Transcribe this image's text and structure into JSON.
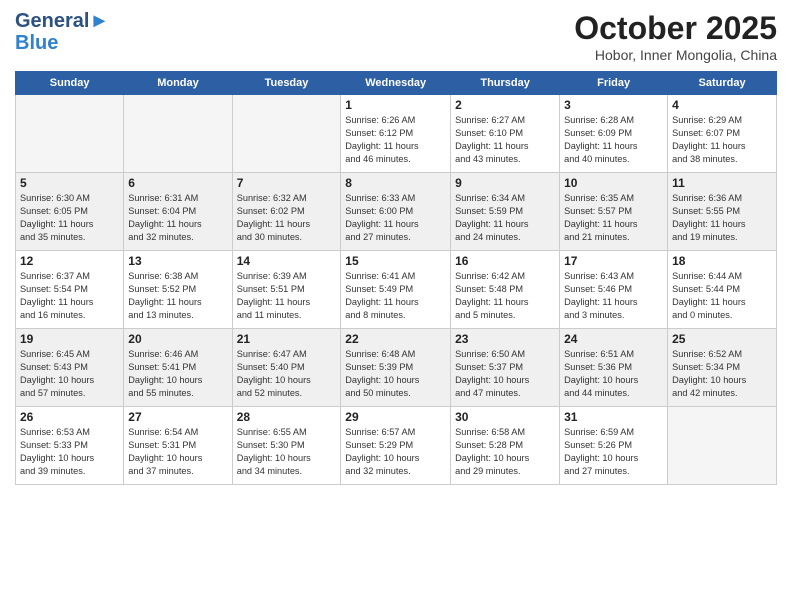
{
  "header": {
    "logo_line1": "General",
    "logo_line2": "Blue",
    "month": "October 2025",
    "location": "Hobor, Inner Mongolia, China"
  },
  "weekdays": [
    "Sunday",
    "Monday",
    "Tuesday",
    "Wednesday",
    "Thursday",
    "Friday",
    "Saturday"
  ],
  "weeks": [
    [
      {
        "day": "",
        "info": ""
      },
      {
        "day": "",
        "info": ""
      },
      {
        "day": "",
        "info": ""
      },
      {
        "day": "1",
        "info": "Sunrise: 6:26 AM\nSunset: 6:12 PM\nDaylight: 11 hours\nand 46 minutes."
      },
      {
        "day": "2",
        "info": "Sunrise: 6:27 AM\nSunset: 6:10 PM\nDaylight: 11 hours\nand 43 minutes."
      },
      {
        "day": "3",
        "info": "Sunrise: 6:28 AM\nSunset: 6:09 PM\nDaylight: 11 hours\nand 40 minutes."
      },
      {
        "day": "4",
        "info": "Sunrise: 6:29 AM\nSunset: 6:07 PM\nDaylight: 11 hours\nand 38 minutes."
      }
    ],
    [
      {
        "day": "5",
        "info": "Sunrise: 6:30 AM\nSunset: 6:05 PM\nDaylight: 11 hours\nand 35 minutes."
      },
      {
        "day": "6",
        "info": "Sunrise: 6:31 AM\nSunset: 6:04 PM\nDaylight: 11 hours\nand 32 minutes."
      },
      {
        "day": "7",
        "info": "Sunrise: 6:32 AM\nSunset: 6:02 PM\nDaylight: 11 hours\nand 30 minutes."
      },
      {
        "day": "8",
        "info": "Sunrise: 6:33 AM\nSunset: 6:00 PM\nDaylight: 11 hours\nand 27 minutes."
      },
      {
        "day": "9",
        "info": "Sunrise: 6:34 AM\nSunset: 5:59 PM\nDaylight: 11 hours\nand 24 minutes."
      },
      {
        "day": "10",
        "info": "Sunrise: 6:35 AM\nSunset: 5:57 PM\nDaylight: 11 hours\nand 21 minutes."
      },
      {
        "day": "11",
        "info": "Sunrise: 6:36 AM\nSunset: 5:55 PM\nDaylight: 11 hours\nand 19 minutes."
      }
    ],
    [
      {
        "day": "12",
        "info": "Sunrise: 6:37 AM\nSunset: 5:54 PM\nDaylight: 11 hours\nand 16 minutes."
      },
      {
        "day": "13",
        "info": "Sunrise: 6:38 AM\nSunset: 5:52 PM\nDaylight: 11 hours\nand 13 minutes."
      },
      {
        "day": "14",
        "info": "Sunrise: 6:39 AM\nSunset: 5:51 PM\nDaylight: 11 hours\nand 11 minutes."
      },
      {
        "day": "15",
        "info": "Sunrise: 6:41 AM\nSunset: 5:49 PM\nDaylight: 11 hours\nand 8 minutes."
      },
      {
        "day": "16",
        "info": "Sunrise: 6:42 AM\nSunset: 5:48 PM\nDaylight: 11 hours\nand 5 minutes."
      },
      {
        "day": "17",
        "info": "Sunrise: 6:43 AM\nSunset: 5:46 PM\nDaylight: 11 hours\nand 3 minutes."
      },
      {
        "day": "18",
        "info": "Sunrise: 6:44 AM\nSunset: 5:44 PM\nDaylight: 11 hours\nand 0 minutes."
      }
    ],
    [
      {
        "day": "19",
        "info": "Sunrise: 6:45 AM\nSunset: 5:43 PM\nDaylight: 10 hours\nand 57 minutes."
      },
      {
        "day": "20",
        "info": "Sunrise: 6:46 AM\nSunset: 5:41 PM\nDaylight: 10 hours\nand 55 minutes."
      },
      {
        "day": "21",
        "info": "Sunrise: 6:47 AM\nSunset: 5:40 PM\nDaylight: 10 hours\nand 52 minutes."
      },
      {
        "day": "22",
        "info": "Sunrise: 6:48 AM\nSunset: 5:39 PM\nDaylight: 10 hours\nand 50 minutes."
      },
      {
        "day": "23",
        "info": "Sunrise: 6:50 AM\nSunset: 5:37 PM\nDaylight: 10 hours\nand 47 minutes."
      },
      {
        "day": "24",
        "info": "Sunrise: 6:51 AM\nSunset: 5:36 PM\nDaylight: 10 hours\nand 44 minutes."
      },
      {
        "day": "25",
        "info": "Sunrise: 6:52 AM\nSunset: 5:34 PM\nDaylight: 10 hours\nand 42 minutes."
      }
    ],
    [
      {
        "day": "26",
        "info": "Sunrise: 6:53 AM\nSunset: 5:33 PM\nDaylight: 10 hours\nand 39 minutes."
      },
      {
        "day": "27",
        "info": "Sunrise: 6:54 AM\nSunset: 5:31 PM\nDaylight: 10 hours\nand 37 minutes."
      },
      {
        "day": "28",
        "info": "Sunrise: 6:55 AM\nSunset: 5:30 PM\nDaylight: 10 hours\nand 34 minutes."
      },
      {
        "day": "29",
        "info": "Sunrise: 6:57 AM\nSunset: 5:29 PM\nDaylight: 10 hours\nand 32 minutes."
      },
      {
        "day": "30",
        "info": "Sunrise: 6:58 AM\nSunset: 5:28 PM\nDaylight: 10 hours\nand 29 minutes."
      },
      {
        "day": "31",
        "info": "Sunrise: 6:59 AM\nSunset: 5:26 PM\nDaylight: 10 hours\nand 27 minutes."
      },
      {
        "day": "",
        "info": ""
      }
    ]
  ],
  "shaded_rows": [
    1,
    3
  ]
}
